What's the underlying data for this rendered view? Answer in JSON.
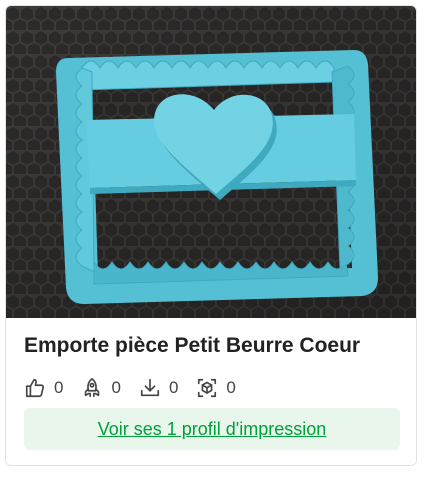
{
  "card": {
    "title": "Emporte pièce Petit Beurre Coeur",
    "image": {
      "subject": "blue 3D-printed petit beurre cookie cutter with heart",
      "colors": {
        "background": "#3c3a39",
        "hex_pattern": "#2e2c2b",
        "plastic": "#5ec8dc",
        "plastic_shade": "#3fa9bf"
      }
    },
    "stats": {
      "likes": "0",
      "boosts": "0",
      "downloads": "0",
      "prints": "0"
    },
    "profile_button_label": "Voir ses 1 profil d'impression"
  },
  "theme": {
    "title_color": "#222222",
    "button_bg": "#e8f6ec",
    "button_text": "#00a13a"
  }
}
